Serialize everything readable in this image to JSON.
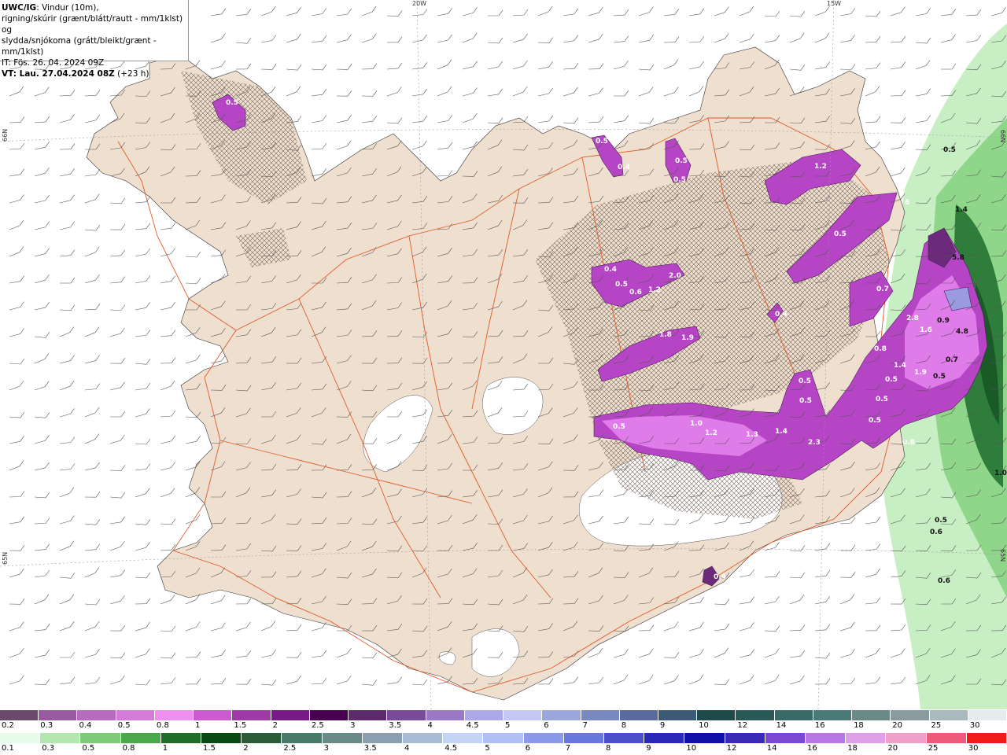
{
  "header": {
    "model": "UWC/IG",
    "line1": ": Vindur (10m),",
    "line2": "rigning/skúrir (grænt/blátt/rautt - mm/1klst) og",
    "line3": "slydda/snjókoma (grátt/bleikt/grænt - mm/1klst)",
    "issue": "IT: Fös. 26. 04. 2024 09Z",
    "valid": "VT: Lau. 27.04.2024 08Z",
    "offset": "(+23 h)"
  },
  "grid_labels": {
    "lon20": "20W",
    "lon15": "15W",
    "lat66_left": "66N",
    "lat66_right": "66N",
    "lat65_left": "65N",
    "lat65_right": "65N"
  },
  "colors": {
    "land": "#efdfcf",
    "roads": "#e05a2a",
    "rain_light": "#c8efc4",
    "rain_mid": "#8fd68a",
    "rain_dark": "#2e7d3a",
    "snow_light": "#e07bea",
    "snow_mid": "#b545c4",
    "snow_dark": "#6b2a7a"
  },
  "precip_labels": [
    {
      "t": "0.5"
    },
    {
      "t": "0.5"
    },
    {
      "t": "0.4"
    },
    {
      "t": "0.5"
    },
    {
      "t": "0.5"
    },
    {
      "t": "0.4"
    },
    {
      "t": "0.5"
    },
    {
      "t": "0.6"
    },
    {
      "t": "1.2"
    },
    {
      "t": "2.0"
    },
    {
      "t": "1.2"
    },
    {
      "t": "0.5"
    },
    {
      "t": "0.7"
    },
    {
      "t": "0.4"
    },
    {
      "t": "1.8"
    },
    {
      "t": "1.9"
    },
    {
      "t": "2.8"
    },
    {
      "t": "1.6"
    },
    {
      "t": "0.9"
    },
    {
      "t": "0.8"
    },
    {
      "t": "1.4"
    },
    {
      "t": "1.9"
    },
    {
      "t": "0.7"
    },
    {
      "t": "0.5"
    },
    {
      "t": "0.5"
    },
    {
      "t": "1.0"
    },
    {
      "t": "1.2"
    },
    {
      "t": "1.3"
    },
    {
      "t": "1.4"
    },
    {
      "t": "2.3"
    },
    {
      "t": "0.5"
    },
    {
      "t": "0.8"
    },
    {
      "t": "0.5"
    },
    {
      "t": "0.5"
    },
    {
      "t": "0.5"
    },
    {
      "t": "0.5"
    },
    {
      "t": "0.5"
    },
    {
      "t": "1.0"
    },
    {
      "t": "0.5"
    },
    {
      "t": "0.4"
    },
    {
      "t": "0.6"
    },
    {
      "t": "0.6"
    },
    {
      "t": "1.4"
    },
    {
      "t": "5.8"
    },
    {
      "t": "4.8"
    },
    {
      "t": "6"
    }
  ],
  "legend_snow": {
    "ticks": [
      "0.2",
      "0.3",
      "0.4",
      "0.5",
      "0.8",
      "1",
      "1.5",
      "2",
      "2.5",
      "3",
      "3.5",
      "4",
      "4.5",
      "5",
      "6",
      "7",
      "8",
      "9",
      "10",
      "12",
      "14",
      "16",
      "18",
      "20",
      "25",
      "30"
    ],
    "colors": [
      "#6b4a6e",
      "#9a5aa0",
      "#b86cc0",
      "#d47ad8",
      "#f08ff2",
      "#cc5ad0",
      "#a03aa8",
      "#7a1a88",
      "#4a0050",
      "#5c2a6c",
      "#7a4a9a",
      "#9a78c8",
      "#aaa8e8",
      "#c4c8f4",
      "#9aa6dc",
      "#7888c0",
      "#5a6aa0",
      "#3a5a78",
      "#1e4a4a",
      "#2a5a58",
      "#3a6a68",
      "#4a7a78",
      "#6a8a88",
      "#8a9aa0",
      "#aab8c0",
      "#e6ecee"
    ]
  },
  "legend_rain": {
    "ticks": [
      "0.1",
      "0.3",
      "0.5",
      "0.8",
      "1",
      "1.5",
      "2",
      "2.5",
      "3",
      "3.5",
      "4",
      "4.5",
      "5",
      "6",
      "7",
      "8",
      "9",
      "10",
      "12",
      "14",
      "16",
      "18",
      "20",
      "25",
      "30"
    ],
    "colors": [
      "#e8fae8",
      "#b4e6b0",
      "#7ecc7a",
      "#4aa84a",
      "#1e6e2a",
      "#0a4a14",
      "#2a5a3a",
      "#4a7a6a",
      "#6a8a8a",
      "#8aa0b0",
      "#a8bcd4",
      "#c4d4f4",
      "#b0c0f4",
      "#8a9ae8",
      "#6a78dc",
      "#4a50cc",
      "#2a28b8",
      "#1010a8",
      "#3a2ab8",
      "#7a48d4",
      "#b878e4",
      "#e0a0e8",
      "#f0a0c8",
      "#f05a7a",
      "#f01a1a"
    ]
  }
}
